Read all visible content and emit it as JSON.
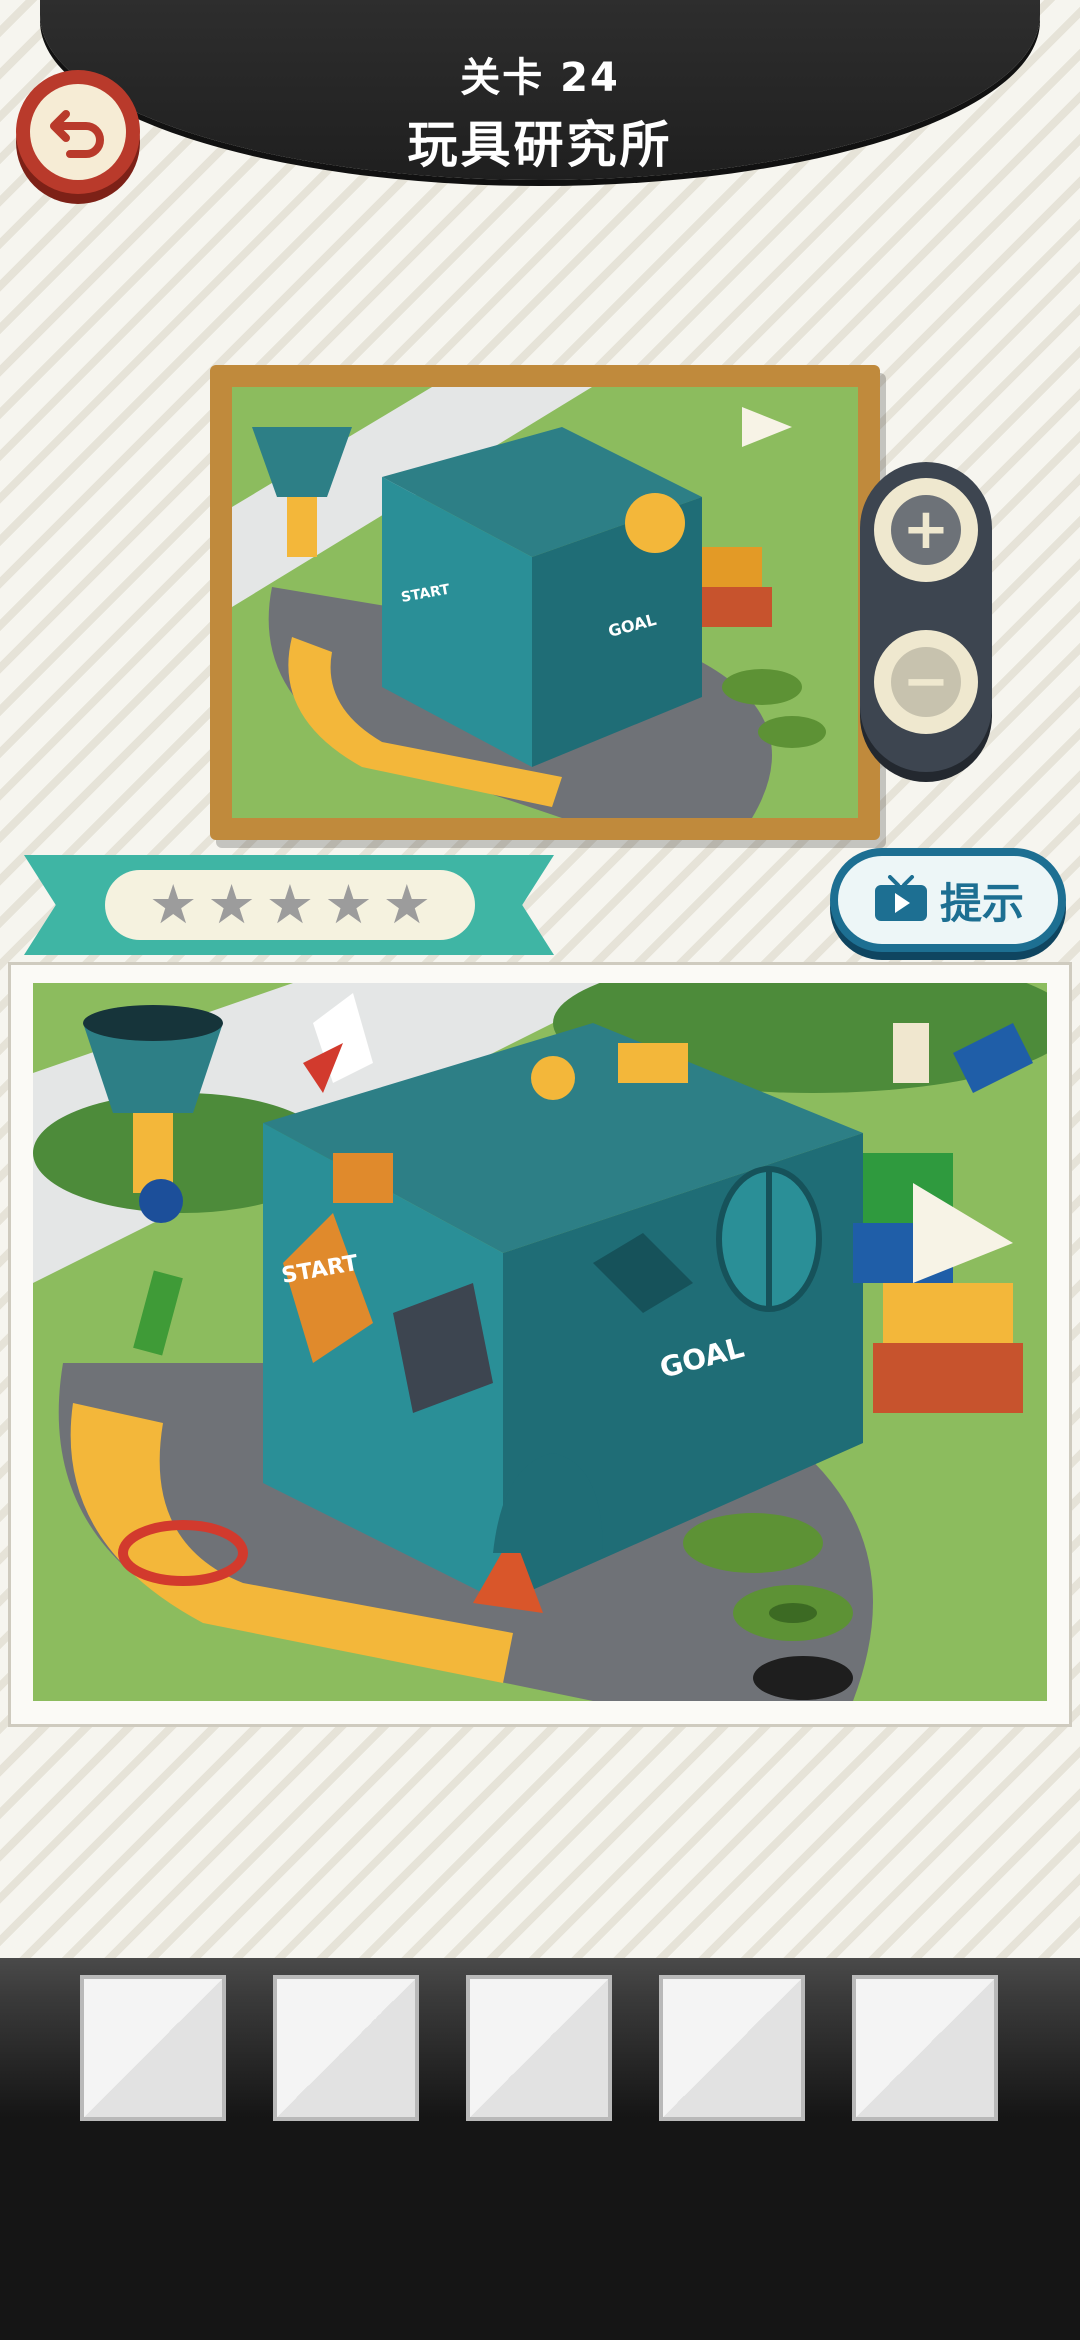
{
  "header": {
    "level_number": "关卡 24",
    "level_name": "玩具研究所"
  },
  "controls": {
    "back": "back-arrow-icon",
    "zoom_in": "+",
    "zoom_out": "−",
    "hint_label": "提示"
  },
  "rating": {
    "stars_total": 5,
    "stars_earned": 0
  },
  "scene": {
    "start_sign": "START",
    "goal_sign": "GOAL"
  },
  "answers": {
    "found": 0,
    "total": 5
  }
}
